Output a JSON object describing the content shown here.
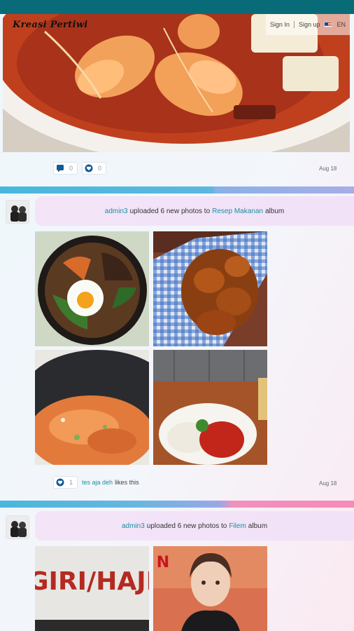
{
  "header": {
    "logo_text": "Kreasi Pertiwi",
    "sign_in": "Sign In",
    "sign_up": "Sign up",
    "language": "EN",
    "flag_icon": "us-flag-icon",
    "bar_color": "#0a6b78"
  },
  "post1": {
    "comment_count": "0",
    "like_count": "0",
    "date": "Aug 18"
  },
  "post2": {
    "user": "admin3",
    "action_text": "uploaded 6 new photos to",
    "album": "Resep Makanan",
    "album_suffix": "album",
    "like_count": "1",
    "liker": "tes aja deh",
    "likes_suffix": "likes this",
    "date": "Aug 18"
  },
  "post3": {
    "user": "admin3",
    "action_text": "uploaded 6 new photos to",
    "album": "Filem",
    "album_suffix": "album",
    "poster1_title": "GIRI/HAJI",
    "poster2_logo": "N"
  },
  "colors": {
    "link": "#1a8fa3",
    "banner": "#f3e4f8",
    "divider_blue": "#48b7dc",
    "divider_pink": "#f58bb9"
  }
}
